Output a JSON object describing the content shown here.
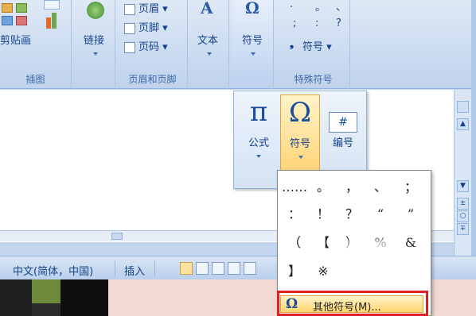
{
  "ribbon": {
    "clipboard": {
      "paste_label": "剪贴画",
      "group_label": "插图"
    },
    "link": {
      "label": "链接"
    },
    "header_footer": {
      "items": [
        {
          "label": "页眉 ▾"
        },
        {
          "label": "页脚 ▾"
        },
        {
          "label": "页码 ▾"
        }
      ],
      "group_label": "页眉和页脚"
    },
    "text": {
      "label": "文本"
    },
    "symbol": {
      "label": "符号",
      "glyph": "Ω"
    },
    "special_symbols": {
      "row1": [
        ".",
        "。",
        "、"
      ],
      "row2": [
        ";",
        ":",
        "?"
      ],
      "symbol_dropdown": "符号 ▾",
      "bullet": "❟",
      "group_label": "特殊符号"
    }
  },
  "popup_insert": {
    "buttons": [
      {
        "glyph": "π",
        "label": "公式"
      },
      {
        "glyph": "Ω",
        "label": "符号"
      },
      {
        "glyph": "#",
        "label": "编号"
      }
    ]
  },
  "symbol_grid": {
    "rows": [
      [
        "……",
        "。",
        "，",
        "、",
        "；"
      ],
      [
        "：",
        "！",
        "？",
        "“",
        "”"
      ],
      [
        "（",
        "【",
        "）",
        "%",
        "&"
      ],
      [
        "】",
        "※",
        "",
        "",
        ""
      ]
    ],
    "more_label": "其他符号(M)...",
    "more_icon": "Ω"
  },
  "statusbar": {
    "language": "中文(简体，中国)",
    "mode": "插入"
  },
  "scrollbar": {
    "up": "▲",
    "down": "▼",
    "prev": "±",
    "select": "○",
    "next": "∓"
  }
}
